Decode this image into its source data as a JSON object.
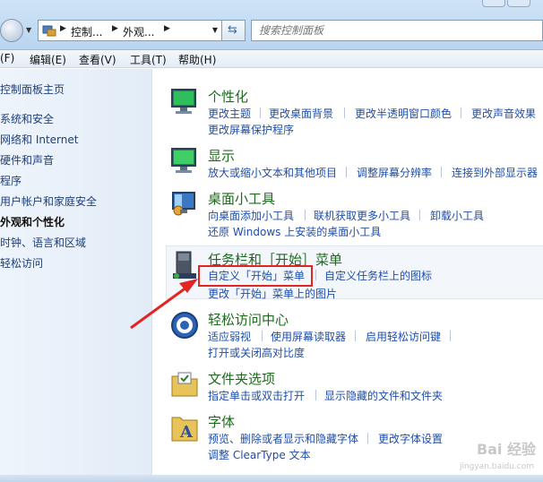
{
  "address": {
    "crumbs": [
      "控制...",
      "外观..."
    ],
    "search_placeholder": "搜索控制面板"
  },
  "menu": [
    "(F)",
    "编辑(E)",
    "查看(V)",
    "工具(T)",
    "帮助(H)"
  ],
  "sidebar": {
    "items": [
      {
        "label": "控制面板主页",
        "active": false
      },
      {
        "label": "系统和安全",
        "active": false
      },
      {
        "label": "网络和 Internet",
        "active": false
      },
      {
        "label": "硬件和声音",
        "active": false
      },
      {
        "label": "程序",
        "active": false
      },
      {
        "label": "用户帐户和家庭安全",
        "active": false
      },
      {
        "label": "外观和个性化",
        "active": true
      },
      {
        "label": "时钟、语言和区域",
        "active": false
      },
      {
        "label": "轻松访问",
        "active": false
      }
    ]
  },
  "categories": [
    {
      "title": "个性化",
      "icon": "personalization-icon",
      "links": [
        "更改主题",
        "更改桌面背景",
        "更改半透明窗口颜色",
        "更改声音效果",
        "更改屏幕保护程序"
      ]
    },
    {
      "title": "显示",
      "icon": "display-icon",
      "links": [
        "放大或缩小文本和其他项目",
        "调整屏幕分辨率",
        "连接到外部显示器"
      ]
    },
    {
      "title": "桌面小工具",
      "icon": "gadgets-icon",
      "links": [
        "向桌面添加小工具",
        "联机获取更多小工具",
        "卸载小工具",
        "还原 Windows 上安装的桌面小工具"
      ]
    },
    {
      "title": "任务栏和［开始］菜单",
      "icon": "taskbar-icon",
      "links": [
        "自定义「开始」菜单",
        "自定义任务栏上的图标",
        "更改「开始」菜单上的图片"
      ]
    },
    {
      "title": "轻松访问中心",
      "icon": "ease-of-access-icon",
      "links": [
        "适应弱视",
        "使用屏幕读取器",
        "启用轻松访问键",
        "打开或关闭高对比度"
      ]
    },
    {
      "title": "文件夹选项",
      "icon": "folder-options-icon",
      "links": [
        "指定单击或双击打开",
        "显示隐藏的文件和文件夹"
      ]
    },
    {
      "title": "字体",
      "icon": "fonts-icon",
      "links": [
        "预览、删除或者显示和隐藏字体",
        "更改字体设置",
        "调整 ClearType 文本"
      ]
    }
  ],
  "watermark": {
    "text": "Bai 经验",
    "sub": "jingyan.baidu.com"
  },
  "colors": {
    "title_green": "#1c6b1c",
    "link_blue": "#1f4ea8",
    "highlight_red": "#e22424"
  }
}
